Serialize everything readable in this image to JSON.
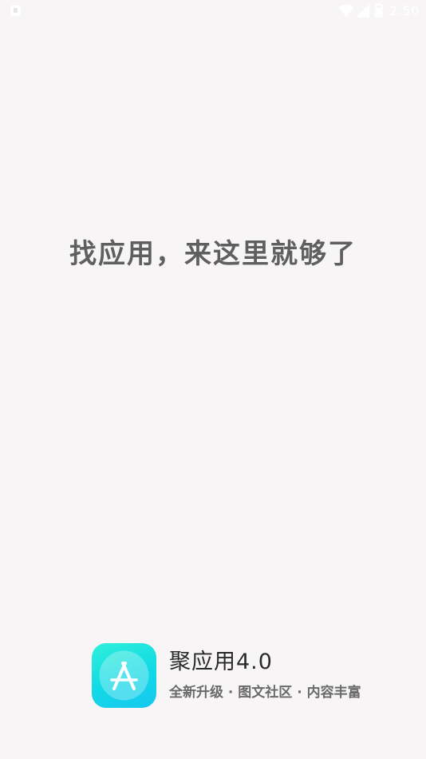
{
  "status_bar": {
    "time": "2:50",
    "icons": [
      "notification-icon",
      "wifi-icon",
      "signal-icon",
      "battery-icon"
    ]
  },
  "splash": {
    "slogan": "找应用，来这里就够了"
  },
  "brand": {
    "app_name": "聚应用4.0",
    "tagline": "全新升级 · 图文社区 · 内容丰富",
    "logo_icon": "app-store-icon",
    "logo_colors": [
      "#2ef0d8",
      "#16c7f0"
    ]
  }
}
